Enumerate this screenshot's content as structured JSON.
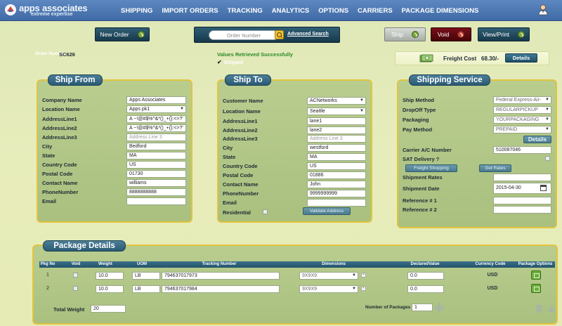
{
  "app": {
    "logo_name": "apps associates",
    "logo_tagline": "extreme expertise",
    "nav": [
      "SHIPPING",
      "IMPORT ORDERS",
      "TRACKING",
      "ANALYTICS",
      "OPTIONS",
      "CARRIERS",
      "PACKAGE DIMENSIONS"
    ]
  },
  "toolbar": {
    "new_order": "New Order",
    "order_number_placeholder": "Order Number",
    "advanced_search": "Advanced Search",
    "ship": "Ship",
    "void": "Void",
    "view_print": "View/Print"
  },
  "order": {
    "label": "Order Number",
    "value": "SC626",
    "status_message": "Values Retrieved Successfully",
    "shipped_label": "Shipped",
    "freight_cost_label": "Freight Cost",
    "freight_cost_value": "68.30/-",
    "details_label": "Details"
  },
  "ship_from": {
    "title": "Ship From",
    "rows": [
      {
        "label": "Company Name",
        "value": "Apps Associates"
      },
      {
        "label": "Location Name",
        "value": "Apps pk1"
      },
      {
        "label": "AddressLine1",
        "value": "A ~!@#$%^&*()_+{}:<>?'"
      },
      {
        "label": "AddressLine2",
        "value": "A ~!@#$%^&*()_+{}:<>?'"
      },
      {
        "label": "AddressLine3",
        "placeholder": "Address Line 3"
      },
      {
        "label": "City",
        "value": "Bedford"
      },
      {
        "label": "State",
        "value": "MA"
      },
      {
        "label": "Country Code",
        "value": "US"
      },
      {
        "label": "Postal Code",
        "value": "01730"
      },
      {
        "label": "Contact Name",
        "value": "williams"
      },
      {
        "label": "PhoneNumber",
        "value": "8888888888"
      },
      {
        "label": "Email",
        "value": ""
      }
    ]
  },
  "ship_to": {
    "title": "Ship To",
    "rows": [
      {
        "label": "Customer Name",
        "value": "ACNetworks"
      },
      {
        "label": "Location Name",
        "value": "Seattle"
      },
      {
        "label": "AddressLine1",
        "value": "lane1"
      },
      {
        "label": "AddressLine2",
        "value": "lane2"
      },
      {
        "label": "AddressLine3",
        "placeholder": "Address Line 3"
      },
      {
        "label": "City",
        "value": "westford"
      },
      {
        "label": "State",
        "value": "MA"
      },
      {
        "label": "Country Code",
        "value": "US"
      },
      {
        "label": "Postal Code",
        "value": "01886"
      },
      {
        "label": "Contact Name",
        "value": "John"
      },
      {
        "label": "PhoneNumber",
        "value": "9999999999"
      },
      {
        "label": "Email",
        "value": ""
      }
    ],
    "residential_label": "Residential",
    "validate_address": "Validate Address"
  },
  "shipping_service": {
    "title": "Shipping Service",
    "ship_method_label": "Ship Method",
    "ship_method_value": "Federal Express-Air-",
    "dropoff_label": "DropOff Type",
    "dropoff_value": "REGULARPICKUP",
    "packaging_label": "Packaging",
    "packaging_value": "YOURPACKAGING",
    "pay_method_label": "Pay Method",
    "pay_method_value": "PREPAID",
    "details_btn": "Details",
    "carrier_ac_label": "Carrier A/C Number",
    "carrier_ac_value": "510087046",
    "sat_delivery_label": "SAT Delivery ?",
    "freight_shopping": "Freight Shopping",
    "get_rates": "Get Rates",
    "shipment_rates_label": "Shipment Rates",
    "shipment_date_label": "Shipment Date",
    "shipment_date_value": "2015-04-30",
    "reference1_label": "Reference # 1",
    "reference2_label": "Reference # 2"
  },
  "package_details": {
    "title": "Package Details",
    "columns": [
      "Pkg No",
      "Void",
      "Weight",
      "UOM",
      "Tracking Number",
      "Dimensions",
      "DeclaredValue",
      "Currency Code",
      "Package Options"
    ],
    "rows": [
      {
        "pkg_no": "1",
        "weight": "10.0",
        "uom": "LB",
        "tracking": "794637017973",
        "dimensions": "9X9X9",
        "declared": "0.0",
        "currency": "USD"
      },
      {
        "pkg_no": "2",
        "weight": "10.0",
        "uom": "LB",
        "tracking": "794637017984",
        "dimensions": "9X9X9",
        "declared": "0.0",
        "currency": "USD"
      }
    ],
    "total_weight_label": "Total Weight",
    "total_weight_value": "20",
    "num_packages_label": "Number of Packages",
    "num_packages_value": "1"
  },
  "colors": {
    "nav_bar": "#4a76b2",
    "panel_bg": "#b3c889",
    "panel_border": "#e2c43e",
    "title_pill": "#3a6c86",
    "success_text": "#2b8a2b"
  }
}
